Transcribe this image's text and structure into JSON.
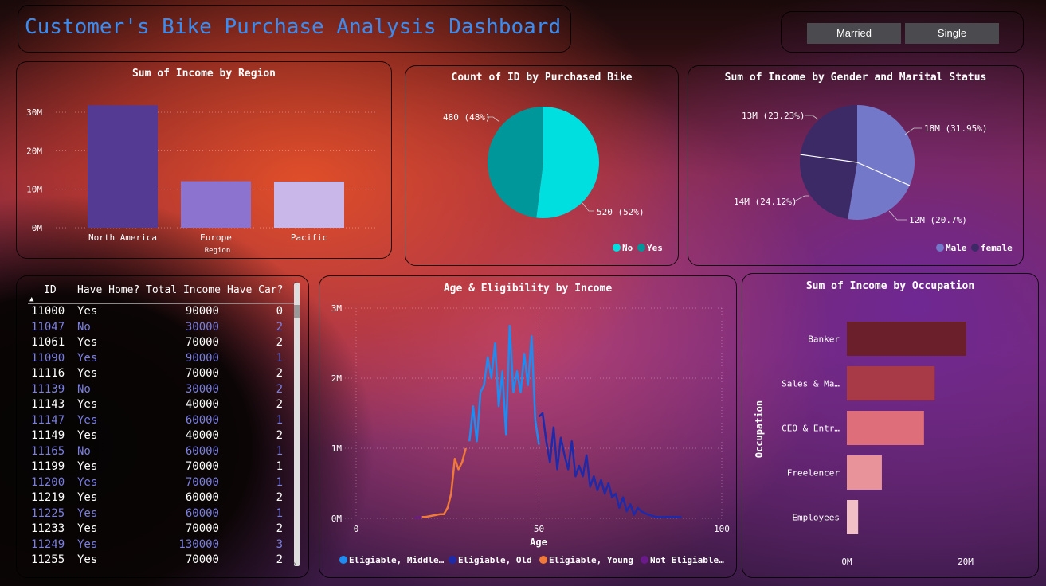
{
  "title": "Customer's Bike Purchase Analysis Dashboard",
  "slicer": {
    "options": [
      "Married",
      "Single"
    ]
  },
  "colors": {
    "title": "#3b8cf0",
    "region_bars": [
      "#553a94",
      "#8b73cf",
      "#c9b7ea"
    ],
    "pie_no": "#00dfe0",
    "pie_yes": "#00979a",
    "gender_male": "#7478c8",
    "gender_female": "#3b2a66",
    "occupation_bars": [
      "#6b1f2b",
      "#a83a47",
      "#de6f7a",
      "#e8929a",
      "#f1c0c6"
    ],
    "line_middle": "#1e8cf0",
    "line_old": "#1f2aa8",
    "line_young": "#f07a3a",
    "line_not": "#6a1a8a",
    "table_odd_text": "#ffffff",
    "table_even_text": "#7b7fe0"
  },
  "region_chart": {
    "title": "Sum of Income by Region",
    "xlabel": "Region",
    "yticks": [
      "30M",
      "20M",
      "10M",
      "0M"
    ]
  },
  "purchase_chart": {
    "title": "Count of ID by Purchased Bike",
    "label_yes": "480 (48%)",
    "label_no": "520 (52%)",
    "legend": [
      "No",
      "Yes"
    ]
  },
  "gender_chart": {
    "title": "Sum of Income by Gender and Marital Status",
    "labels": [
      "18M (31.95%)",
      "12M (20.7%)",
      "14M (24.12%)",
      "13M (23.23%)"
    ],
    "legend": [
      "Male",
      "female"
    ]
  },
  "table": {
    "headers": [
      "ID",
      "Have Home?",
      "Total Income",
      "Have Car?"
    ],
    "rows": [
      [
        "11000",
        "Yes",
        "90000",
        "0"
      ],
      [
        "11047",
        "No",
        "30000",
        "2"
      ],
      [
        "11061",
        "Yes",
        "70000",
        "2"
      ],
      [
        "11090",
        "Yes",
        "90000",
        "1"
      ],
      [
        "11116",
        "Yes",
        "70000",
        "2"
      ],
      [
        "11139",
        "No",
        "30000",
        "2"
      ],
      [
        "11143",
        "Yes",
        "40000",
        "2"
      ],
      [
        "11147",
        "Yes",
        "60000",
        "1"
      ],
      [
        "11149",
        "Yes",
        "40000",
        "2"
      ],
      [
        "11165",
        "No",
        "60000",
        "1"
      ],
      [
        "11199",
        "Yes",
        "70000",
        "1"
      ],
      [
        "11200",
        "Yes",
        "70000",
        "1"
      ],
      [
        "11219",
        "Yes",
        "60000",
        "2"
      ],
      [
        "11225",
        "Yes",
        "60000",
        "1"
      ],
      [
        "11233",
        "Yes",
        "70000",
        "2"
      ],
      [
        "11249",
        "Yes",
        "130000",
        "3"
      ],
      [
        "11255",
        "Yes",
        "70000",
        "2"
      ]
    ]
  },
  "age_chart": {
    "title": "Age & Eligibility by Income",
    "xlabel": "Age",
    "yticks": [
      "3M",
      "2M",
      "1M",
      "0M"
    ],
    "xticks": [
      "0",
      "50",
      "100"
    ],
    "legend": [
      "Eligiable, Middle…",
      "Eligiable, Old",
      "Eligiable, Young",
      "Not Eligiable…"
    ]
  },
  "occupation_chart": {
    "title": "Sum of Income by Occupation",
    "ylabel": "Occupation",
    "xticks": [
      "0M",
      "20M"
    ]
  },
  "chart_data": [
    {
      "type": "bar",
      "title": "Sum of Income by Region",
      "xlabel": "Region",
      "categories": [
        "North America",
        "Europe",
        "Pacific"
      ],
      "values": [
        31.8,
        12.1,
        12.0
      ],
      "unit": "M",
      "ylim": [
        0,
        32
      ],
      "grid": true
    },
    {
      "type": "pie",
      "title": "Count of ID by Purchased Bike",
      "categories": [
        "No",
        "Yes"
      ],
      "values": [
        520,
        480
      ],
      "legend": "bottom-right"
    },
    {
      "type": "pie",
      "title": "Sum of Income by Gender and Marital Status",
      "categories": [
        "Male",
        "Male",
        "female",
        "female"
      ],
      "values": [
        18,
        12,
        14,
        13
      ],
      "percent": [
        31.95,
        20.7,
        24.12,
        23.23
      ],
      "legend": "bottom-right"
    },
    {
      "type": "line",
      "title": "Age & Eligibility by Income",
      "xlabel": "Age",
      "xlim": [
        0,
        100
      ],
      "ylim": [
        0,
        3
      ],
      "unit": "M",
      "series": [
        {
          "name": "Eligiable, Middle…",
          "x": [
            31,
            32,
            33,
            34,
            35,
            36,
            37,
            38,
            39,
            40,
            41,
            42,
            43,
            44,
            45,
            46,
            47,
            48,
            49,
            50
          ],
          "y": [
            1.1,
            1.6,
            1.1,
            1.8,
            1.9,
            2.3,
            2.0,
            2.5,
            1.6,
            2.1,
            1.2,
            2.75,
            1.8,
            2.1,
            1.8,
            2.35,
            1.9,
            2.6,
            1.4,
            1.05
          ]
        },
        {
          "name": "Eligiable, Old",
          "x": [
            50,
            51,
            52,
            53,
            54,
            55,
            56,
            57,
            58,
            59,
            60,
            61,
            62,
            63,
            64,
            65,
            66,
            67,
            68,
            69,
            70,
            71,
            72,
            73,
            74,
            75,
            76,
            77,
            78,
            80,
            82,
            84,
            86,
            88,
            89
          ],
          "y": [
            1.45,
            1.5,
            1.1,
            0.8,
            1.3,
            0.7,
            1.15,
            0.9,
            0.7,
            1.1,
            0.6,
            0.75,
            0.6,
            0.9,
            0.45,
            0.6,
            0.4,
            0.55,
            0.35,
            0.5,
            0.3,
            0.35,
            0.15,
            0.3,
            0.1,
            0.2,
            0.05,
            0.15,
            0.1,
            0.05,
            0.02,
            0.02,
            0.02,
            0.02,
            0.02
          ]
        },
        {
          "name": "Eligiable, Young",
          "x": [
            18,
            19,
            20,
            21,
            22,
            23,
            24,
            25,
            26,
            27,
            28,
            29,
            30
          ],
          "y": [
            0.02,
            0.02,
            0.03,
            0.04,
            0.05,
            0.06,
            0.06,
            0.15,
            0.35,
            0.85,
            0.7,
            0.8,
            1.0
          ]
        },
        {
          "name": "Not Eligiable…",
          "x": [
            16,
            17,
            18
          ],
          "y": [
            0.01,
            0.01,
            0.02
          ]
        }
      ],
      "legend": "bottom",
      "grid": true
    },
    {
      "type": "bar",
      "orientation": "horizontal",
      "title": "Sum of Income by Occupation",
      "ylabel": "Occupation",
      "categories": [
        "Banker",
        "Sales & Ma…",
        "CEO & Entr…",
        "Freelencer",
        "Employees"
      ],
      "values": [
        20.1,
        14.8,
        13.0,
        5.9,
        1.9
      ],
      "unit": "M",
      "xlim": [
        0,
        20
      ]
    }
  ]
}
